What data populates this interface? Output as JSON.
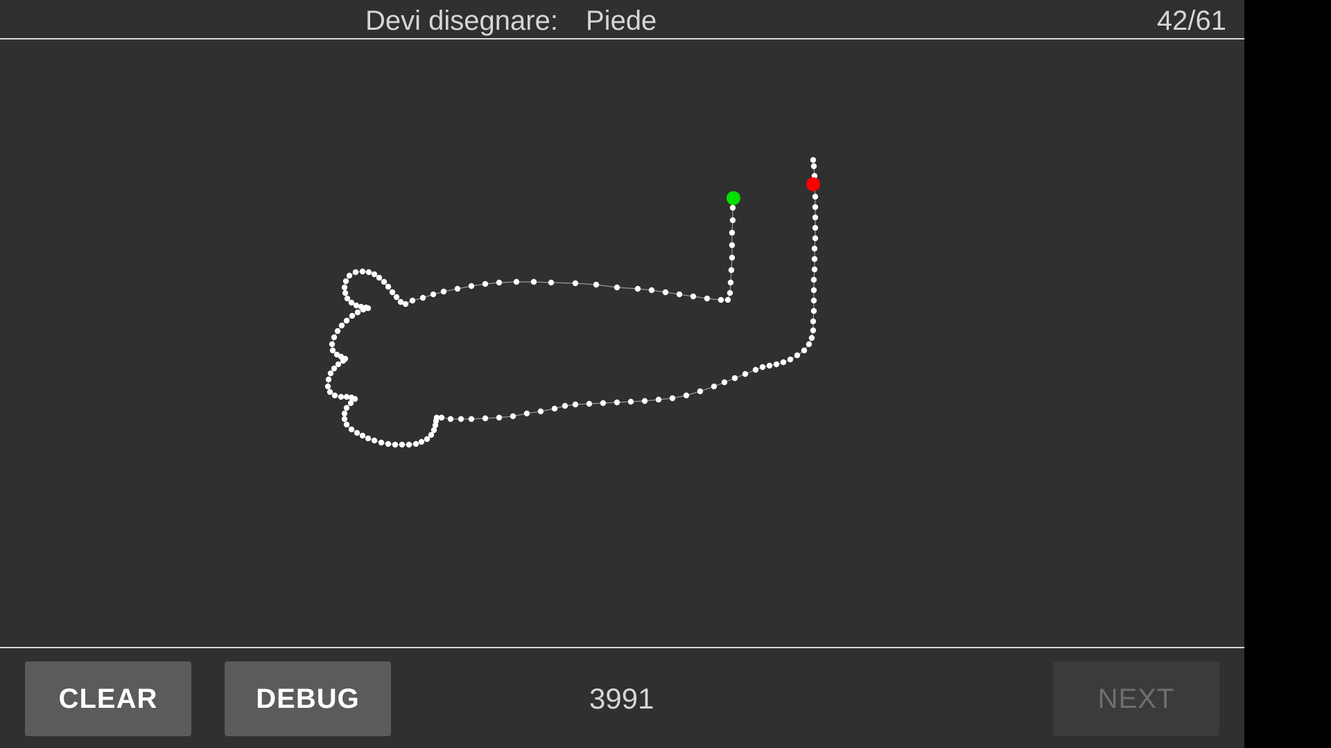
{
  "header": {
    "prompt_label": "Devi disegnare:",
    "target_word": "Piede",
    "progress": "42/61"
  },
  "footer": {
    "clear_label": "CLEAR",
    "debug_label": "DEBUG",
    "score": "3991",
    "next_label": "NEXT",
    "next_enabled": false
  },
  "colors": {
    "background": "#303030",
    "stroke_point": "#ffffff",
    "start_marker": "#00e000",
    "end_marker": "#ff0000"
  }
}
